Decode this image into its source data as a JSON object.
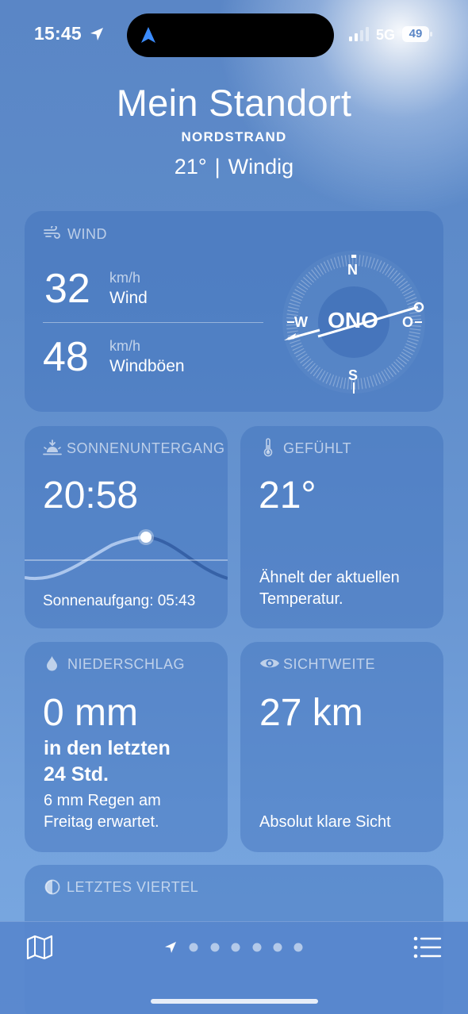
{
  "status": {
    "time": "15:45",
    "network": "5G",
    "battery": "49"
  },
  "location": {
    "title": "Mein Standort",
    "subtitle": "NORDSTRAND",
    "temp": "21°",
    "separator": "|",
    "condition": "Windig"
  },
  "wind": {
    "label": "WIND",
    "speed": "32",
    "speed_unit": "km/h",
    "speed_label": "Wind",
    "gust": "48",
    "gust_unit": "km/h",
    "gust_label": "Windböen",
    "direction": "ONO",
    "compass": {
      "n": "N",
      "s": "S",
      "w": "W",
      "o": "O"
    }
  },
  "sunset": {
    "label": "SONNENUNTERGANG",
    "time": "20:58",
    "sunrise": "Sonnenaufgang: 05:43"
  },
  "feels_like": {
    "label": "GEFÜHLT",
    "value": "21°",
    "desc_line1": "Ähnelt der aktuellen",
    "desc_line2": "Temperatur."
  },
  "precipitation": {
    "label": "NIEDERSCHLAG",
    "value": "0 mm",
    "period_line1": "in den letzten",
    "period_line2": "24 Std.",
    "forecast_line1": "6 mm Regen am",
    "forecast_line2": "Freitag erwartet."
  },
  "visibility": {
    "label": "SICHTWEITE",
    "value": "27 km",
    "desc": "Absolut klare Sicht"
  },
  "moon": {
    "label": "LETZTES VIERTEL"
  },
  "colors": {
    "sky_top": "#5a86c6",
    "sky_bottom": "#7aa9e2",
    "card": "#3c6eb9",
    "island_arrow": "#3b8cff"
  },
  "icons": [
    "location-arrow-icon",
    "signal-icon",
    "battery-icon",
    "wind-icon",
    "sunset-icon",
    "thermometer-icon",
    "raindrop-icon",
    "eye-icon",
    "moon-half-icon",
    "map-icon",
    "list-icon"
  ]
}
